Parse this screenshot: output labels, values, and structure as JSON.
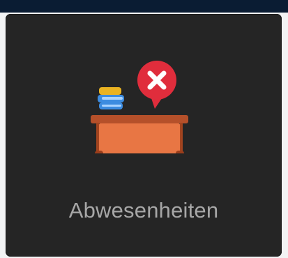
{
  "tile": {
    "label": "Abwesenheiten",
    "icon": "desk-absence-icon",
    "badge_icon": "close-icon"
  },
  "colors": {
    "tile_background": "#252525",
    "label": "#a7a7a7",
    "desk_top": "#b5502a",
    "desk_front": "#e87644",
    "desk_legs": "#a2441f",
    "book_yellow": "#eab322",
    "book_blue": "#3c8ce0",
    "badge_red": "#e02d3c"
  }
}
